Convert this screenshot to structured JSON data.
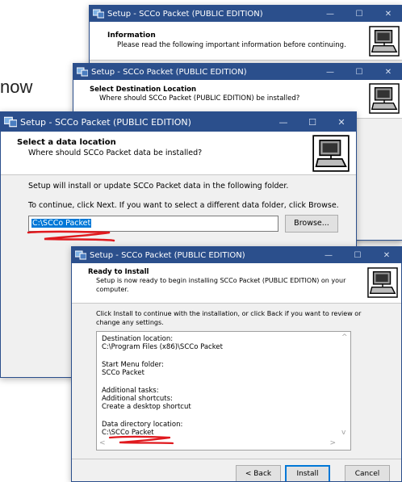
{
  "background_text": "now",
  "colors": {
    "titlebar": "#2b4f8c",
    "selection": "#0078d7",
    "annotation": "#e0191e"
  },
  "window1": {
    "title": "Setup - SCCo Packet (PUBLIC EDITION)",
    "header_title": "Information",
    "header_subtitle": "Please read the following important information before continuing."
  },
  "window2": {
    "title": "Setup - SCCo Packet (PUBLIC EDITION)",
    "header_title": "Select Destination Location",
    "header_subtitle": "Where should SCCo Packet (PUBLIC EDITION) be installed?"
  },
  "window3": {
    "title": "Setup - SCCo Packet (PUBLIC EDITION)",
    "header_title": "Select a data location",
    "header_subtitle": "Where should SCCo Packet data be installed?",
    "text1": "Setup will install or update SCCo Packet data in the following folder.",
    "text2": "To continue, click Next.  If you want to select a different data folder, click Browse.",
    "path_value": "C:\\SCCo Packet",
    "browse_label": "Browse..."
  },
  "window4": {
    "title": "Setup - SCCo Packet (PUBLIC EDITION)",
    "header_title": "Ready to Install",
    "header_subtitle_1": "Setup is now ready to begin installing SCCo Packet (PUBLIC EDITION) on your",
    "header_subtitle_2": "computer.",
    "intro_1": "Click Install to continue with the installation, or click Back if you want to review or",
    "intro_2": "change any settings.",
    "memo": [
      "Destination location:",
      "      C:\\Program Files (x86)\\SCCo Packet",
      "",
      "Start Menu folder:",
      "      SCCo Packet",
      "",
      "Additional tasks:",
      "      Additional shortcuts:",
      "         Create a desktop shortcut",
      "",
      "Data directory location:",
      "      C:\\SCCo Packet"
    ],
    "back_label": "< Back",
    "install_label": "Install",
    "cancel_label": "Cancel"
  },
  "window_controls": {
    "minimize": "—",
    "maximize": "☐",
    "close": "✕"
  }
}
